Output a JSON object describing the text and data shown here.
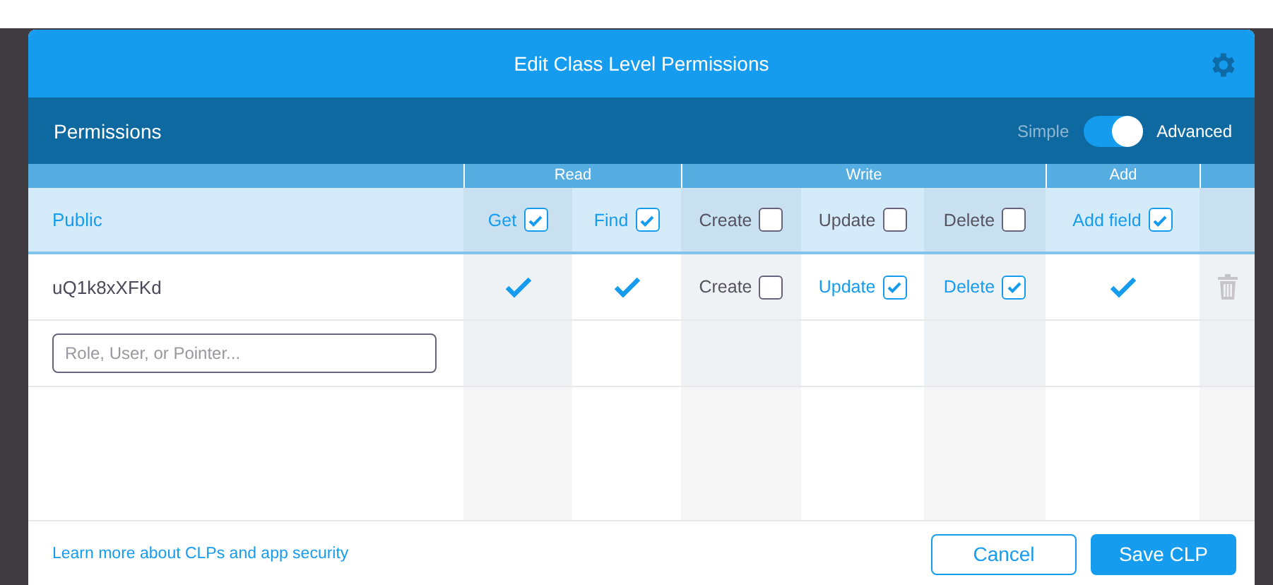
{
  "modal": {
    "title": "Edit Class Level Permissions"
  },
  "subheader": {
    "title": "Permissions",
    "mode_left": "Simple",
    "mode_right": "Advanced",
    "advanced": true
  },
  "groups": [
    {
      "label": "Read"
    },
    {
      "label": "Write"
    },
    {
      "label": "Add"
    }
  ],
  "rows": [
    {
      "kind": "public",
      "name": "Public",
      "cells": [
        {
          "kind": "checkbox",
          "label": "Get",
          "checked": true
        },
        {
          "kind": "checkbox",
          "label": "Find",
          "checked": true
        },
        {
          "kind": "checkbox",
          "label": "Create",
          "checked": false
        },
        {
          "kind": "checkbox",
          "label": "Update",
          "checked": false
        },
        {
          "kind": "checkbox",
          "label": "Delete",
          "checked": false
        },
        {
          "kind": "checkbox",
          "label": "Add field",
          "checked": true
        }
      ],
      "deletable": false
    },
    {
      "kind": "entry",
      "name": "uQ1k8xXFKd",
      "cells": [
        {
          "kind": "tick",
          "checked": true
        },
        {
          "kind": "tick",
          "checked": true
        },
        {
          "kind": "checkbox",
          "label": "Create",
          "checked": false
        },
        {
          "kind": "checkbox",
          "label": "Update",
          "checked": true
        },
        {
          "kind": "checkbox",
          "label": "Delete",
          "checked": true
        },
        {
          "kind": "tick",
          "checked": true
        }
      ],
      "deletable": true
    }
  ],
  "new_entry": {
    "placeholder": "Role, User, or Pointer..."
  },
  "footer": {
    "link": "Learn more about CLPs and app security",
    "buttons": [
      {
        "kind": "secondary",
        "label": "Cancel"
      },
      {
        "kind": "primary",
        "label": "Save CLP"
      }
    ]
  }
}
